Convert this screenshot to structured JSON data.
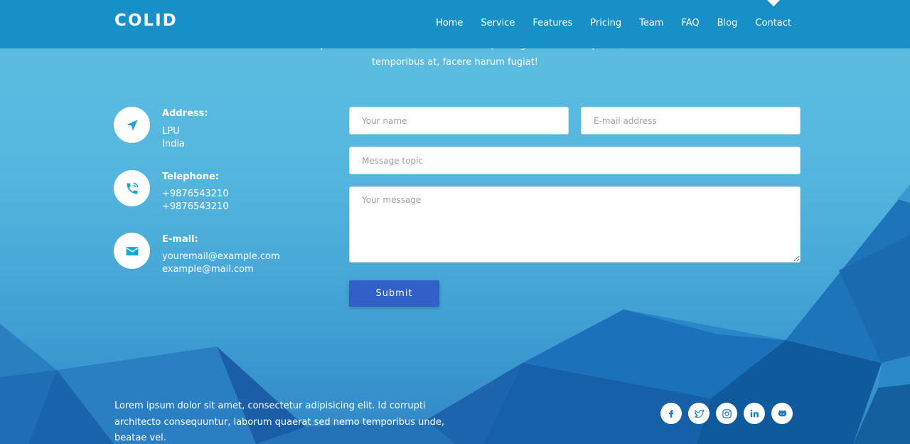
{
  "header": {
    "logo": "COLID",
    "nav": [
      {
        "label": "Home"
      },
      {
        "label": "Service"
      },
      {
        "label": "Features"
      },
      {
        "label": "Pricing"
      },
      {
        "label": "Team"
      },
      {
        "label": "FAQ"
      },
      {
        "label": "Blog"
      },
      {
        "label": "Contact"
      }
    ]
  },
  "intro": {
    "line1": "Lorem ipsum dolor sit amet, consectetur adipisicing elit. Velit voluptates,",
    "line2": "temporibus at, facere harum fugiat!"
  },
  "contact_info": {
    "address": {
      "title": "Address:",
      "lines": [
        "LPU",
        "India"
      ],
      "icon": "navigation-arrow-icon"
    },
    "telephone": {
      "title": "Telephone:",
      "lines": [
        "+9876543210",
        "+9876543210"
      ],
      "icon": "phone-call-icon"
    },
    "email": {
      "title": "E-mail:",
      "lines": [
        "youremail@example.com",
        "example@mail.com"
      ],
      "icon": "envelope-icon"
    }
  },
  "form": {
    "name_placeholder": "Your name",
    "email_placeholder": "E-mail address",
    "topic_placeholder": "Message topic",
    "message_placeholder": "Your message",
    "submit_label": "Submit"
  },
  "footer": {
    "text": "Lorem ipsum dolor sit amet, consectetur adipisicing elit. Id corrupti architecto consequuntur, laborum quaerat sed nemo temporibus unde, beatae vel.",
    "social": [
      {
        "icon": "facebook-icon",
        "glyph": "f"
      },
      {
        "icon": "twitter-icon",
        "glyph": "t"
      },
      {
        "icon": "instagram-icon",
        "glyph": "ig"
      },
      {
        "icon": "linkedin-icon",
        "glyph": "in"
      },
      {
        "icon": "github-icon",
        "glyph": "gh"
      }
    ]
  },
  "colors": {
    "header": "#1690c6",
    "accent_icon": "#17a3d6",
    "submit": "#3060c8"
  }
}
